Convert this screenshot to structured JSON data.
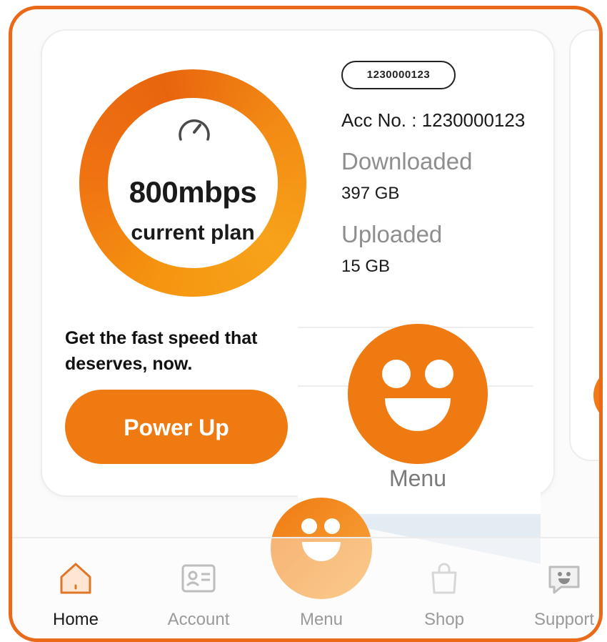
{
  "plan_card": {
    "speed": "800mbps",
    "plan_label": "current plan",
    "account_pill": "1230000123",
    "account_label": "Acc No. : 1230000123",
    "downloaded_label": "Downloaded",
    "downloaded_value": "397 GB",
    "uploaded_label": "Uploaded",
    "uploaded_value": "15 GB",
    "promo_text": "Get the fast speed that deserves, now.",
    "power_up_label": "Power Up"
  },
  "menu_popover": {
    "label": "Menu",
    "icon": "smiley-face-icon"
  },
  "bottom_nav": {
    "items": [
      {
        "label": "Home",
        "icon": "home-icon",
        "active": true
      },
      {
        "label": "Account",
        "icon": "id-card-icon",
        "active": false
      },
      {
        "label": "Menu",
        "icon": "smiley-face-icon",
        "active": false
      },
      {
        "label": "Shop",
        "icon": "shopping-bag-icon",
        "active": false
      },
      {
        "label": "Support",
        "icon": "chat-smiley-icon",
        "active": false
      }
    ]
  },
  "colors": {
    "accent": "#f07a12",
    "frame": "#ea6a1a",
    "muted_text": "#8e8e8e"
  }
}
